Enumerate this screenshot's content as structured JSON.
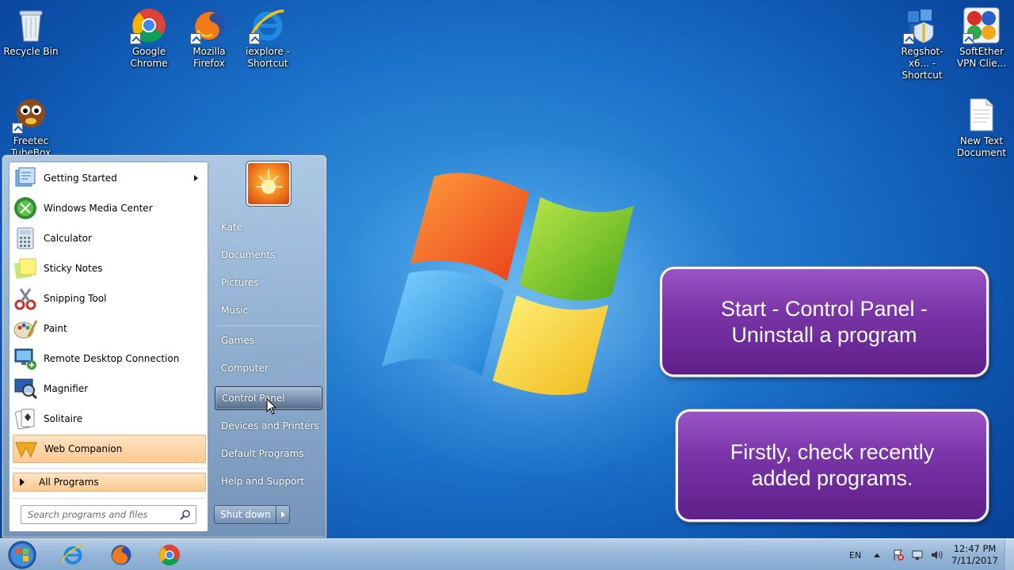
{
  "desktop": {
    "icons": [
      {
        "label": "Recycle Bin",
        "icon": "recycle-bin-icon"
      },
      {
        "label": "Google Chrome",
        "icon": "chrome-icon"
      },
      {
        "label": "Mozilla Firefox",
        "icon": "firefox-icon"
      },
      {
        "label": "iexplore - Shortcut",
        "icon": "ie-icon"
      },
      {
        "label": "Freetec TubeBox",
        "icon": "tubebox-icon"
      },
      {
        "label": "Regshot-x6... - Shortcut",
        "icon": "regshot-icon"
      },
      {
        "label": "SoftEther VPN Clie...",
        "icon": "softether-icon"
      },
      {
        "label": "New Text Document",
        "icon": "text-document-icon"
      }
    ]
  },
  "callouts": [
    {
      "text": "Start - Control Panel - Uninstall a program"
    },
    {
      "text": "Firstly, check recently added programs."
    }
  ],
  "start_menu": {
    "programs": [
      {
        "label": "Getting Started",
        "icon": "getting-started-icon"
      },
      {
        "label": "Windows Media Center",
        "icon": "media-center-icon"
      },
      {
        "label": "Calculator",
        "icon": "calculator-icon"
      },
      {
        "label": "Sticky Notes",
        "icon": "sticky-notes-icon"
      },
      {
        "label": "Snipping Tool",
        "icon": "snipping-tool-icon"
      },
      {
        "label": "Paint",
        "icon": "paint-icon"
      },
      {
        "label": "Remote Desktop Connection",
        "icon": "remote-desktop-icon"
      },
      {
        "label": "Magnifier",
        "icon": "magnifier-icon"
      },
      {
        "label": "Solitaire",
        "icon": "solitaire-icon"
      },
      {
        "label": "Web Companion",
        "icon": "web-companion-icon"
      }
    ],
    "all_programs": "All Programs",
    "search_placeholder": "Search programs and files",
    "right_items": [
      "Kate",
      "Documents",
      "Pictures",
      "Music",
      "Games",
      "Computer",
      "Control Panel",
      "Devices and Printers",
      "Default Programs",
      "Help and Support"
    ],
    "active_item": "Control Panel",
    "shutdown_label": "Shut down"
  },
  "taskbar": {
    "pinned": [
      "internet-explorer-icon",
      "firefox-icon",
      "chrome-icon"
    ],
    "language": "EN",
    "time": "12:47 PM",
    "date": "7/11/2017"
  }
}
